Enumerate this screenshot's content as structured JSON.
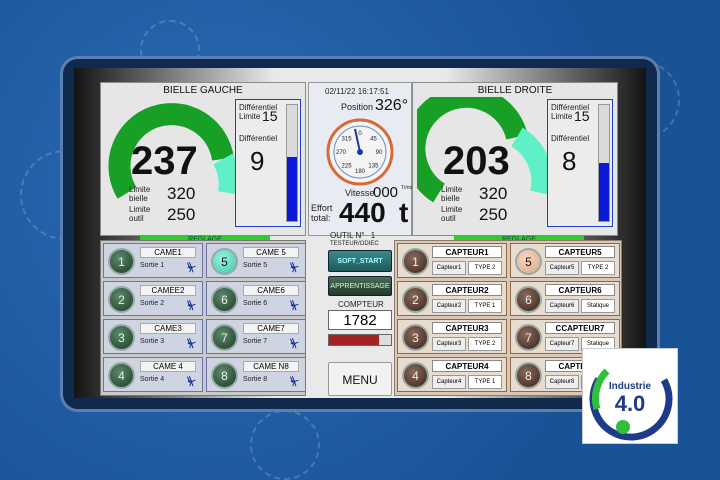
{
  "left_gauge": {
    "title": "BIELLE GAUCHE",
    "value": "237",
    "limite_bielle_label": "Limite bielle",
    "limite_bielle": "320",
    "limite_outil_label": "Limite outil",
    "limite_outil": "250",
    "diff_limite_label": "Différentiel Limite",
    "diff_limite": "15",
    "diff_label": "Différentiel",
    "diff_value": "9",
    "diff_fill": 0.55,
    "reglage": "REGLAGE"
  },
  "right_gauge": {
    "title": "BIELLE DROITE",
    "value": "203",
    "limite_bielle_label": "Limite bielle",
    "limite_bielle": "320",
    "limite_outil_label": "Limite outil",
    "limite_outil": "250",
    "diff_limite_label": "Différentiel Limite",
    "diff_limite": "15",
    "diff_label": "Différentiel",
    "diff_value": "8",
    "diff_fill": 0.5,
    "reglage": "REGLAGE"
  },
  "center": {
    "datetime": "02/11/22 16:17:51",
    "position_label": "Position",
    "position_value": "326°",
    "dial_ticks": [
      "0",
      "45",
      "90",
      "135",
      "180",
      "225",
      "270",
      "315"
    ],
    "vitesse_label": "Vitesse",
    "vitesse_value": "000",
    "vitesse_unit": "Tr/min",
    "effort_label": "Effort total:",
    "effort_value": "440",
    "effort_unit": "t",
    "outil_label": "OUTIL N°",
    "outil_value": "1",
    "outil_name": "TESTEUR/ODIEC",
    "soft_start": "SOFT_START",
    "apprentissage": "APPRENTISSAGE",
    "compteur_label": "COMPTEUR",
    "compteur_value": "1782",
    "menu": "MENU"
  },
  "cames": [
    {
      "num": "1",
      "label": "CAME1",
      "sortie": "Sortie 1",
      "active": false
    },
    {
      "num": "5",
      "label": "CAME 5",
      "sortie": "Sortie 5",
      "active": true
    },
    {
      "num": "2",
      "label": "CAMEE2",
      "sortie": "Sortie 2",
      "active": false
    },
    {
      "num": "6",
      "label": "CAME6",
      "sortie": "Sortie 6",
      "active": false
    },
    {
      "num": "3",
      "label": "CAME3",
      "sortie": "Sortie 3",
      "active": false
    },
    {
      "num": "7",
      "label": "CAME7",
      "sortie": "Sortie 7",
      "active": false
    },
    {
      "num": "4",
      "label": "CAME 4",
      "sortie": "Sortie 4",
      "active": false
    },
    {
      "num": "8",
      "label": "CAME N8",
      "sortie": "Sortie 8",
      "active": false
    }
  ],
  "capteurs": [
    {
      "num": "1",
      "label": "CAPTEUR1",
      "sub": "Capteur1",
      "type": "TYPE 2",
      "active": false
    },
    {
      "num": "5",
      "label": "CAPTEUR5",
      "sub": "Capteur5",
      "type": "TYPE 2",
      "active": true
    },
    {
      "num": "2",
      "label": "CAPTEUR2",
      "sub": "Capteur2",
      "type": "TYPE 1",
      "active": false
    },
    {
      "num": "6",
      "label": "CAPTEUR6",
      "sub": "Capteur6",
      "type": "Statique",
      "active": false
    },
    {
      "num": "3",
      "label": "CAPTEUR3",
      "sub": "Capteur3",
      "type": "TYPE 2",
      "active": false
    },
    {
      "num": "7",
      "label": "CCAPTEUR7",
      "sub": "Capteur7",
      "type": "Statique",
      "active": false
    },
    {
      "num": "4",
      "label": "CAPTEUR4",
      "sub": "Capteur4",
      "type": "TYPE 1",
      "active": false
    },
    {
      "num": "8",
      "label": "CAPTEUR8",
      "sub": "Capteur8",
      "type": "Statique",
      "active": false
    }
  ],
  "logo": {
    "line1": "Industrie",
    "line2": "4.0"
  },
  "colors": {
    "gauge_green": "#17a025",
    "gauge_mint": "#5ff0c8",
    "diff_blue": "#0c1ad8",
    "reglage": "#2ecc2e",
    "background": "#1f5da3"
  }
}
